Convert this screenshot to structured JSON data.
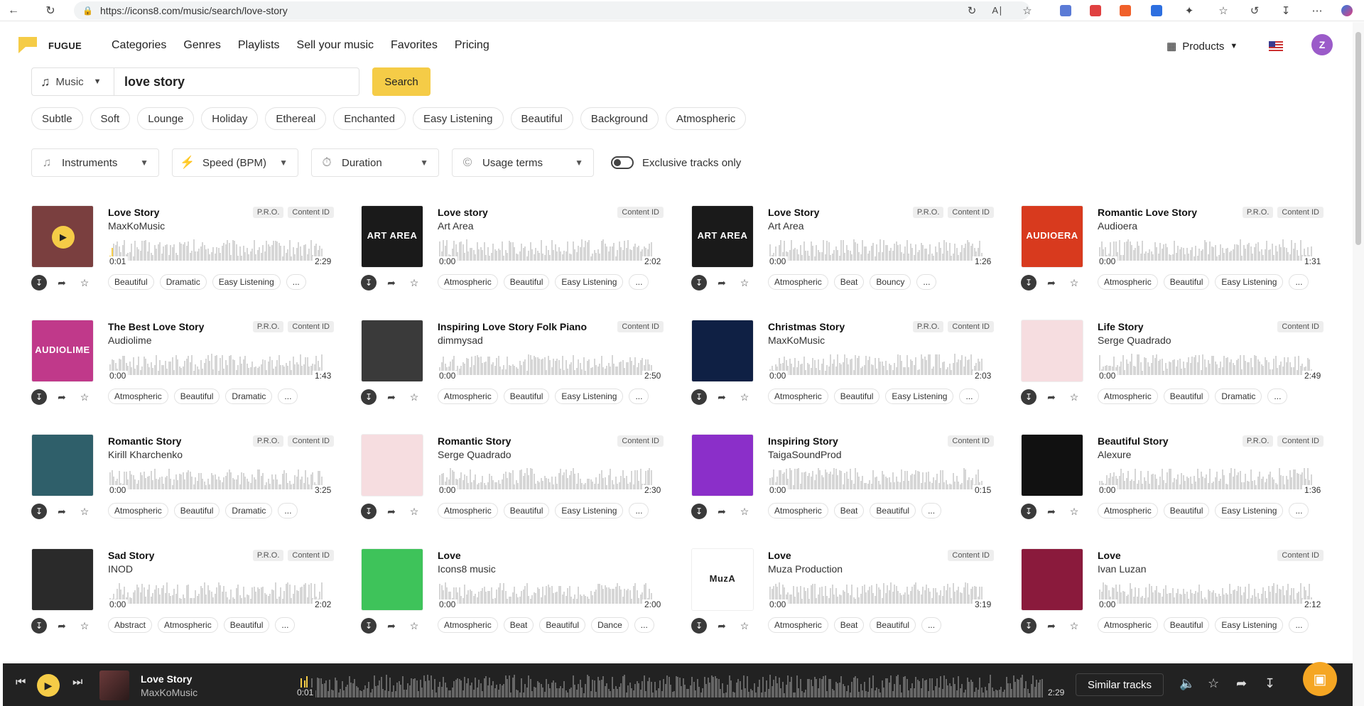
{
  "browser": {
    "url": "https://icons8.com/music/search/love-story"
  },
  "header": {
    "logo_text": "FUGUE",
    "nav": [
      "Categories",
      "Genres",
      "Playlists",
      "Sell your music",
      "Favorites",
      "Pricing"
    ],
    "products_label": "Products",
    "avatar_letter": "Z"
  },
  "search": {
    "category": "Music",
    "query": "love story",
    "button": "Search"
  },
  "suggestions": [
    "Subtle",
    "Soft",
    "Lounge",
    "Holiday",
    "Ethereal",
    "Enchanted",
    "Easy Listening",
    "Beautiful",
    "Background",
    "Atmospheric"
  ],
  "filters": {
    "instruments": "Instruments",
    "speed": "Speed (BPM)",
    "duration": "Duration",
    "usage": "Usage terms",
    "exclusive": "Exclusive tracks only"
  },
  "tracks": [
    {
      "title": "Love Story",
      "artist": "MaxKoMusic",
      "badges": [
        "P.R.O.",
        "Content ID"
      ],
      "start": "0:01",
      "duration": "2:29",
      "tags": [
        "Beautiful",
        "Dramatic",
        "Easy Listening",
        "..."
      ],
      "cover": "#7a3f3f",
      "cover_text": "",
      "progress": 0.01
    },
    {
      "title": "Love story",
      "artist": "Art Area",
      "badges": [
        "Content ID"
      ],
      "start": "0:00",
      "duration": "2:02",
      "tags": [
        "Atmospheric",
        "Beautiful",
        "Easy Listening",
        "..."
      ],
      "cover": "#1a1a1a",
      "cover_text": "ART AREA",
      "progress": 0
    },
    {
      "title": "Love Story",
      "artist": "Art Area",
      "badges": [
        "P.R.O.",
        "Content ID"
      ],
      "start": "0:00",
      "duration": "1:26",
      "tags": [
        "Atmospheric",
        "Beat",
        "Bouncy",
        "..."
      ],
      "cover": "#1a1a1a",
      "cover_text": "ART AREA",
      "progress": 0
    },
    {
      "title": "Romantic Love Story",
      "artist": "Audioera",
      "badges": [
        "P.R.O.",
        "Content ID"
      ],
      "start": "0:00",
      "duration": "1:31",
      "tags": [
        "Atmospheric",
        "Beautiful",
        "Easy Listening",
        "..."
      ],
      "cover": "#d83a1e",
      "cover_text": "AUDIOERA",
      "progress": 0
    },
    {
      "title": "The Best Love Story",
      "artist": "Audiolime",
      "badges": [
        "P.R.O.",
        "Content ID"
      ],
      "start": "0:00",
      "duration": "1:43",
      "tags": [
        "Atmospheric",
        "Beautiful",
        "Dramatic",
        "..."
      ],
      "cover": "#c0398a",
      "cover_text": "AUDIOLIME",
      "progress": 0
    },
    {
      "title": "Inspiring Love Story Folk Piano",
      "artist": "dimmysad",
      "badges": [
        "Content ID"
      ],
      "start": "0:00",
      "duration": "2:50",
      "tags": [
        "Atmospheric",
        "Beautiful",
        "Easy Listening",
        "..."
      ],
      "cover": "#3a3a3a",
      "cover_text": "",
      "progress": 0
    },
    {
      "title": "Christmas Story",
      "artist": "MaxKoMusic",
      "badges": [
        "P.R.O.",
        "Content ID"
      ],
      "start": "0:00",
      "duration": "2:03",
      "tags": [
        "Atmospheric",
        "Beautiful",
        "Easy Listening",
        "..."
      ],
      "cover": "#0f2044",
      "cover_text": "",
      "progress": 0
    },
    {
      "title": "Life Story",
      "artist": "Serge Quadrado",
      "badges": [
        "Content ID"
      ],
      "start": "0:00",
      "duration": "2:49",
      "tags": [
        "Atmospheric",
        "Beautiful",
        "Dramatic",
        "..."
      ],
      "cover": "#f6dde0",
      "cover_text": "",
      "progress": 0
    },
    {
      "title": "Romantic Story",
      "artist": "Kirill Kharchenko",
      "badges": [
        "P.R.O.",
        "Content ID"
      ],
      "start": "0:00",
      "duration": "3:25",
      "tags": [
        "Atmospheric",
        "Beautiful",
        "Dramatic",
        "..."
      ],
      "cover": "#2f5f6a",
      "cover_text": "",
      "progress": 0
    },
    {
      "title": "Romantic Story",
      "artist": "Serge Quadrado",
      "badges": [
        "Content ID"
      ],
      "start": "0:00",
      "duration": "2:30",
      "tags": [
        "Atmospheric",
        "Beautiful",
        "Easy Listening",
        "..."
      ],
      "cover": "#f6dde0",
      "cover_text": "",
      "progress": 0
    },
    {
      "title": "Inspiring Story",
      "artist": "TaigaSoundProd",
      "badges": [
        "Content ID"
      ],
      "start": "0:00",
      "duration": "0:15",
      "tags": [
        "Atmospheric",
        "Beat",
        "Beautiful",
        "..."
      ],
      "cover": "#8b2fc9",
      "cover_text": "",
      "progress": 0
    },
    {
      "title": "Beautiful Story",
      "artist": "Alexure",
      "badges": [
        "P.R.O.",
        "Content ID"
      ],
      "start": "0:00",
      "duration": "1:36",
      "tags": [
        "Atmospheric",
        "Beautiful",
        "Easy Listening",
        "..."
      ],
      "cover": "#111111",
      "cover_text": "",
      "progress": 0
    },
    {
      "title": "Sad Story",
      "artist": "INOD",
      "badges": [
        "P.R.O.",
        "Content ID"
      ],
      "start": "0:00",
      "duration": "2:02",
      "tags": [
        "Abstract",
        "Atmospheric",
        "Beautiful",
        "..."
      ],
      "cover": "#2a2a2a",
      "cover_text": "",
      "progress": 0
    },
    {
      "title": "Love",
      "artist": "Icons8 music",
      "badges": [],
      "start": "0:00",
      "duration": "2:00",
      "tags": [
        "Atmospheric",
        "Beat",
        "Beautiful",
        "Dance",
        "..."
      ],
      "cover": "#3ec35a",
      "cover_text": "",
      "progress": 0
    },
    {
      "title": "Love",
      "artist": "Muza Production",
      "badges": [
        "Content ID"
      ],
      "start": "0:00",
      "duration": "3:19",
      "tags": [
        "Atmospheric",
        "Beat",
        "Beautiful",
        "..."
      ],
      "cover": "#ffffff",
      "cover_text": "MuzA",
      "progress": 0
    },
    {
      "title": "Love",
      "artist": "Ivan Luzan",
      "badges": [
        "Content ID"
      ],
      "start": "0:00",
      "duration": "2:12",
      "tags": [
        "Atmospheric",
        "Beautiful",
        "Easy Listening",
        "..."
      ],
      "cover": "#8a1a3c",
      "cover_text": "",
      "progress": 0
    }
  ],
  "player": {
    "title": "Love Story",
    "artist": "MaxKoMusic",
    "start": "0:01",
    "duration": "2:29",
    "progress": 0.01,
    "similar": "Similar tracks"
  },
  "colors": {
    "accent": "#f5cc47",
    "player_bg": "#222222"
  }
}
